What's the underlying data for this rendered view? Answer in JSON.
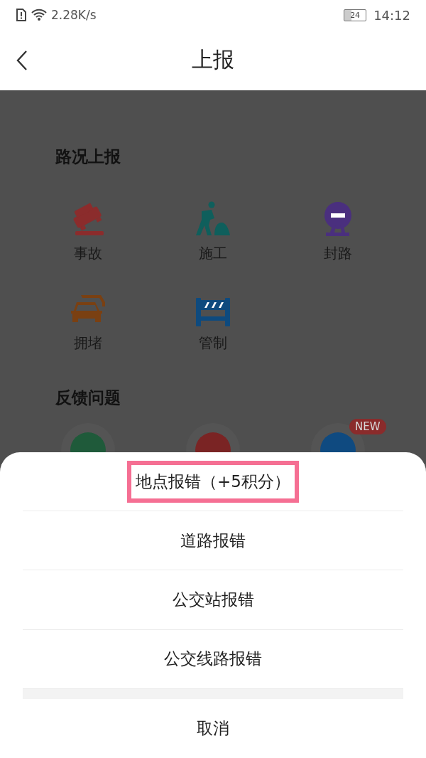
{
  "status_bar": {
    "speed": "2.28K/s",
    "battery": "24",
    "time": "14:12"
  },
  "header": {
    "title": "上报"
  },
  "road_report": {
    "title": "路况上报",
    "items": [
      {
        "kind": "accident",
        "label": "事故",
        "color": "#8b2c2c"
      },
      {
        "kind": "construction",
        "label": "施工",
        "color": "#0f5f5c"
      },
      {
        "kind": "closure",
        "label": "封路",
        "color": "#4a2f7e"
      },
      {
        "kind": "congestion",
        "label": "拥堵",
        "color": "#7a4012"
      },
      {
        "kind": "control",
        "label": "管制",
        "color": "#0e4a7e"
      }
    ]
  },
  "feedback": {
    "title": "反馈问题",
    "items": [
      {
        "color": "#1f5a3a"
      },
      {
        "color": "#7a2424"
      },
      {
        "color": "#0f4a80",
        "badge": "NEW"
      }
    ]
  },
  "sheet": {
    "options": [
      {
        "label": "地点报错（+5积分）",
        "highlighted": true
      },
      {
        "label": "道路报错",
        "highlighted": false
      },
      {
        "label": "公交站报错",
        "highlighted": false
      },
      {
        "label": "公交线路报错",
        "highlighted": false
      }
    ],
    "cancel": "取消"
  }
}
